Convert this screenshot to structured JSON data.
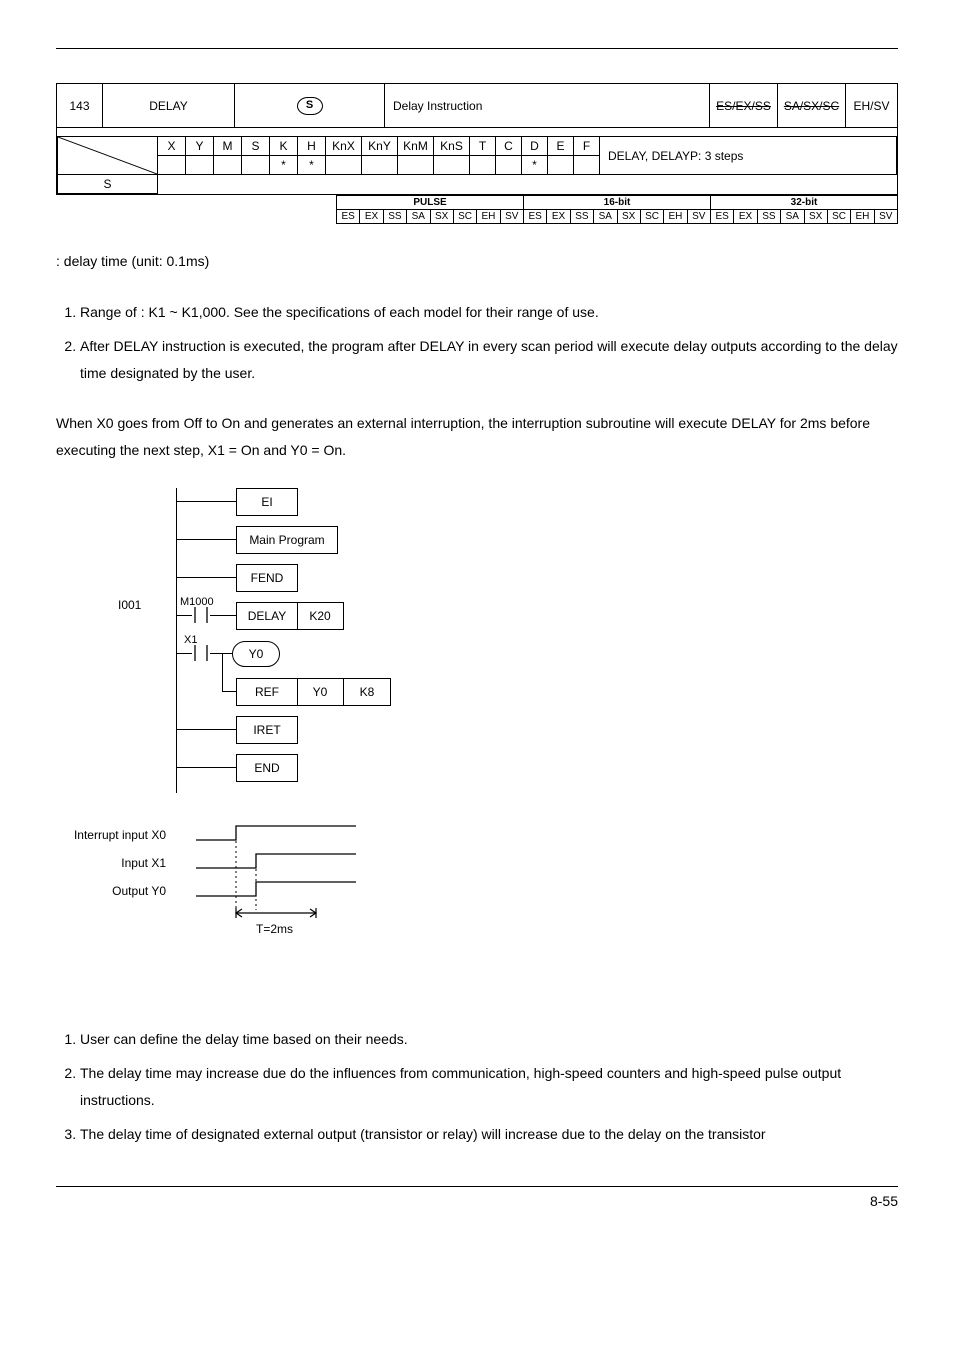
{
  "header": {
    "api_num": "143",
    "mnemonic": "DELAY",
    "operand_sym": "S",
    "func_desc": "Delay Instruction",
    "controllers": [
      "ES/EX/SS",
      "SA/SX/SC",
      "EH/SV"
    ]
  },
  "opgrid": {
    "cols": [
      "X",
      "Y",
      "M",
      "S",
      "K",
      "H",
      "KnX",
      "KnY",
      "KnM",
      "KnS",
      "T",
      "C",
      "D",
      "E",
      "F"
    ],
    "row_label": "S",
    "marks": {
      "K": "*",
      "H": "*",
      "D": "*"
    },
    "steps": "DELAY, DELAYP: 3 steps"
  },
  "pstrip": {
    "groups": [
      "PULSE",
      "16-bit",
      "32-bit"
    ],
    "cols": [
      "ES",
      "EX",
      "SS",
      "SA",
      "SX",
      "SC",
      "EH",
      "SV"
    ]
  },
  "operands_text": ": delay time (unit: 0.1ms)",
  "explanations": [
    "Range of   : K1 ~ K1,000. See the specifications of each model for their range of use.",
    "After DELAY instruction is executed, the program after DELAY in every scan period will execute delay outputs according to the delay time designated by the user."
  ],
  "program_example": "When X0 goes from Off to On and generates an external interruption, the interruption subroutine will execute DELAY for 2ms before executing the next step, X1 = On and Y0 = On.",
  "ladder": {
    "ei": "EI",
    "main": "Main Program",
    "fend": "FEND",
    "i_label": "I001",
    "m1000": "M1000",
    "delay": "DELAY",
    "k20": "K20",
    "x1": "X1",
    "y0_oval": "Y0",
    "ref": "REF",
    "y0": "Y0",
    "k8": "K8",
    "iret": "IRET",
    "end": "END"
  },
  "timing": {
    "sig1": "Interrupt input X0",
    "sig2": "Input X1",
    "sig3": "Output Y0",
    "t": "T=2ms"
  },
  "remarks": [
    "User can define the delay time based on their needs.",
    "The delay time may increase due do the influences from communication, high-speed counters and high-speed pulse output instructions.",
    "The delay time of designated external output (transistor or relay) will increase due to the delay on the transistor"
  ],
  "page": "8-55"
}
